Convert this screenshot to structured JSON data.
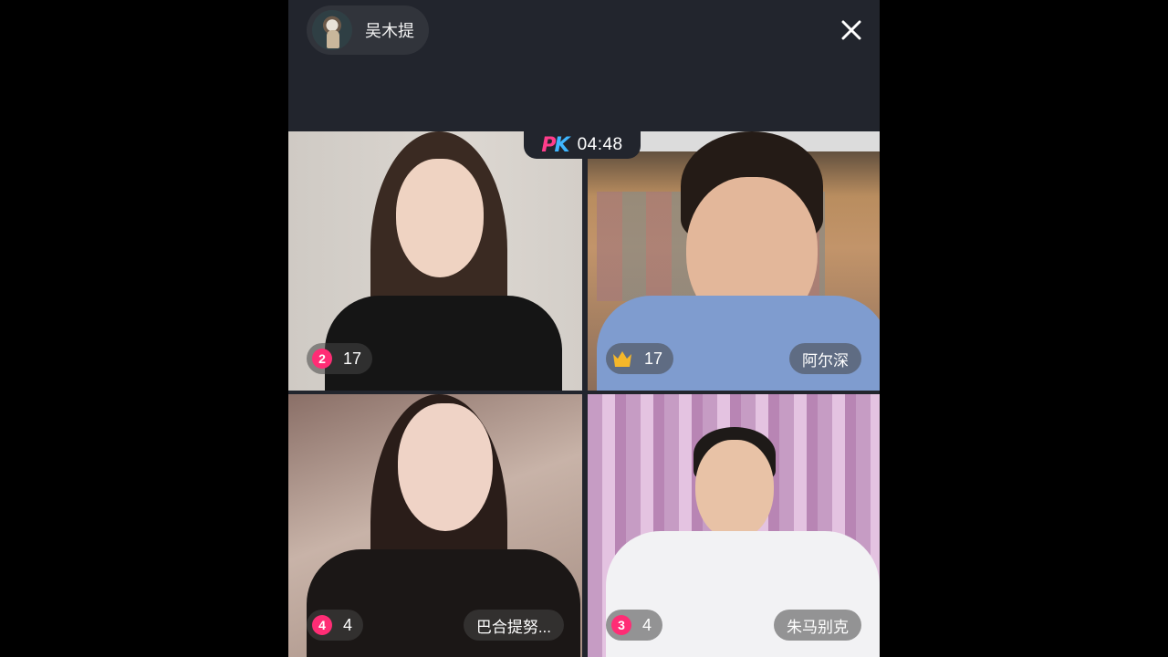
{
  "host": {
    "name": "吴木提"
  },
  "pk": {
    "timer": "04:48"
  },
  "participants": [
    {
      "rank": "2",
      "score": "17",
      "name": ""
    },
    {
      "rank": "1",
      "score": "17",
      "name": "阿尔深",
      "crown": true
    },
    {
      "rank": "4",
      "score": "4",
      "name": "巴合提努..."
    },
    {
      "rank": "3",
      "score": "4",
      "name": "朱马别克"
    }
  ],
  "colors": {
    "accent_pink": "#ff2d75",
    "pk_pink": "#ff3d8b",
    "pk_blue": "#3fb6ff",
    "crown_gold": "#f5b72a",
    "panel_bg": "#22252d"
  },
  "icons": {
    "close": "close-icon",
    "crown": "crown-icon"
  }
}
